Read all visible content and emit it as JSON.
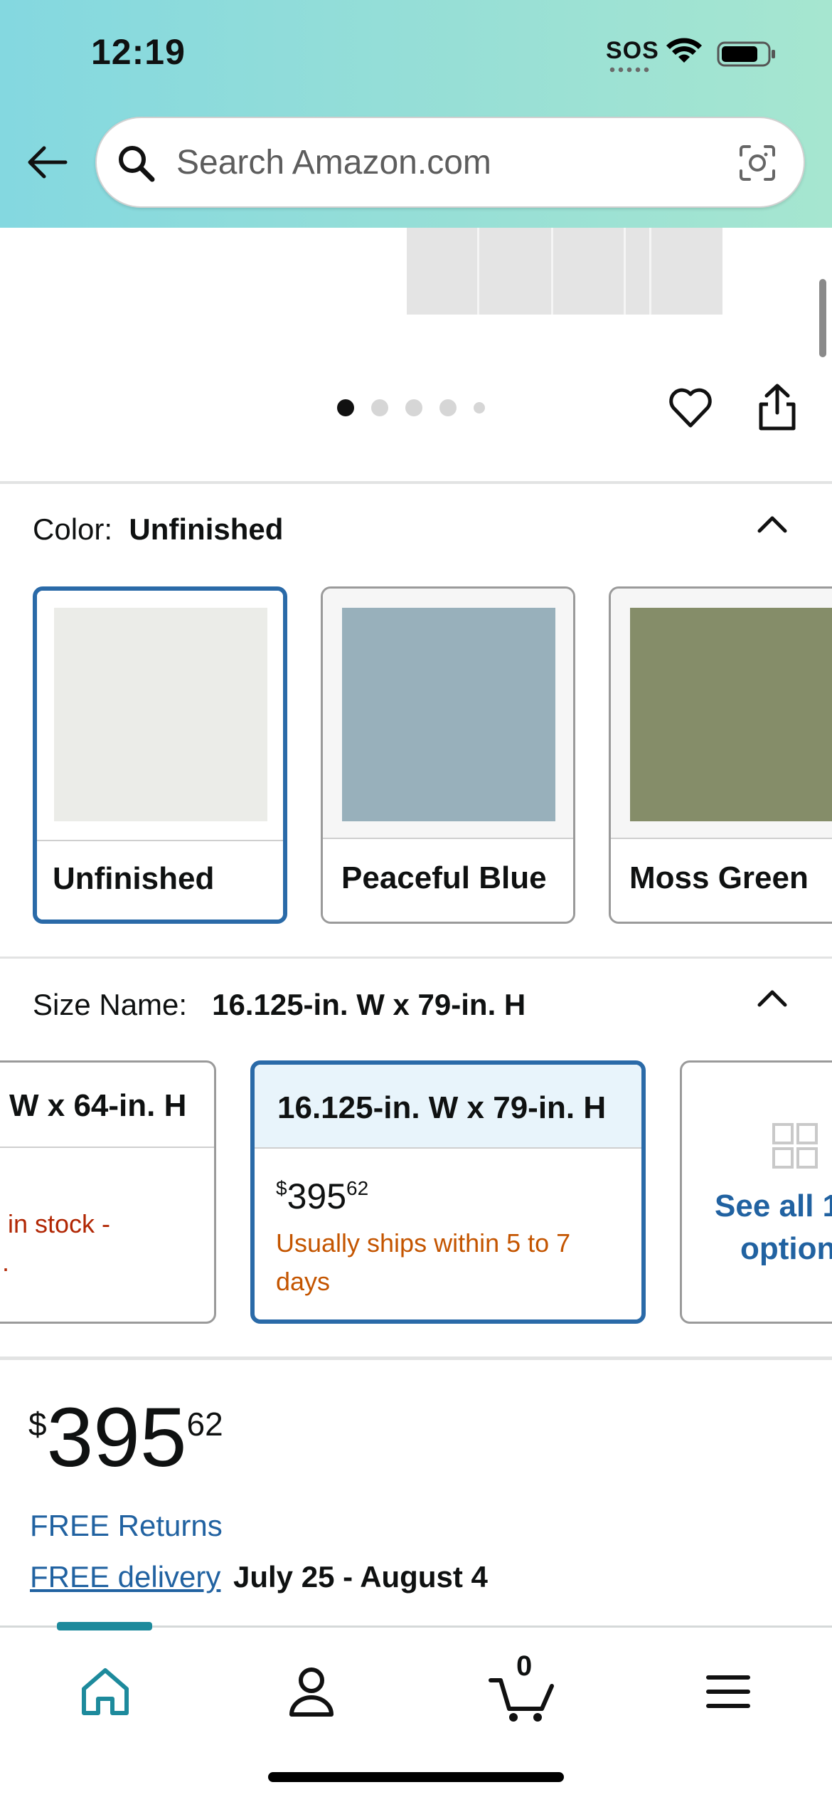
{
  "status_bar": {
    "time": "12:19",
    "sos": "SOS"
  },
  "search": {
    "placeholder": "Search Amazon.com"
  },
  "carousel": {
    "page_count": 5,
    "active_index": 0
  },
  "color_section": {
    "label": "Color:",
    "selected_value": "Unfinished",
    "options": [
      {
        "name": "Unfinished",
        "swatch": "#ebece8",
        "selected": true
      },
      {
        "name": "Peaceful Blue",
        "swatch": "#98b0bb",
        "selected": false
      },
      {
        "name": "Moss Green",
        "swatch": "#858d69",
        "selected": false
      }
    ]
  },
  "size_section": {
    "label": "Size Name:",
    "selected_value": "16.125-in. W x 79-in. H",
    "options": [
      {
        "title": "W x 64-in. H",
        "status_line1": "in stock -",
        "status_line2": "."
      },
      {
        "title": "16.125-in. W x 79-in. H",
        "price_currency": "$",
        "price_whole": "395",
        "price_fraction": "62",
        "ship_line1": "Usually ships within 5 to 7",
        "ship_line2": "days"
      }
    ],
    "see_all_line1": "See all 1",
    "see_all_line2": "option"
  },
  "price": {
    "currency": "$",
    "whole": "395",
    "fraction": "62"
  },
  "returns_label": "FREE Returns",
  "delivery": {
    "link_label": "FREE delivery",
    "date_range": "July 25 - August 4"
  },
  "bottom_nav": {
    "cart_count": "0"
  },
  "colors": {
    "accent_blue": "#2162a1",
    "selected_border": "#2a6aa8",
    "ship_orange": "#c45500",
    "stock_red": "#b12704",
    "nav_teal": "#1d8a9c"
  }
}
